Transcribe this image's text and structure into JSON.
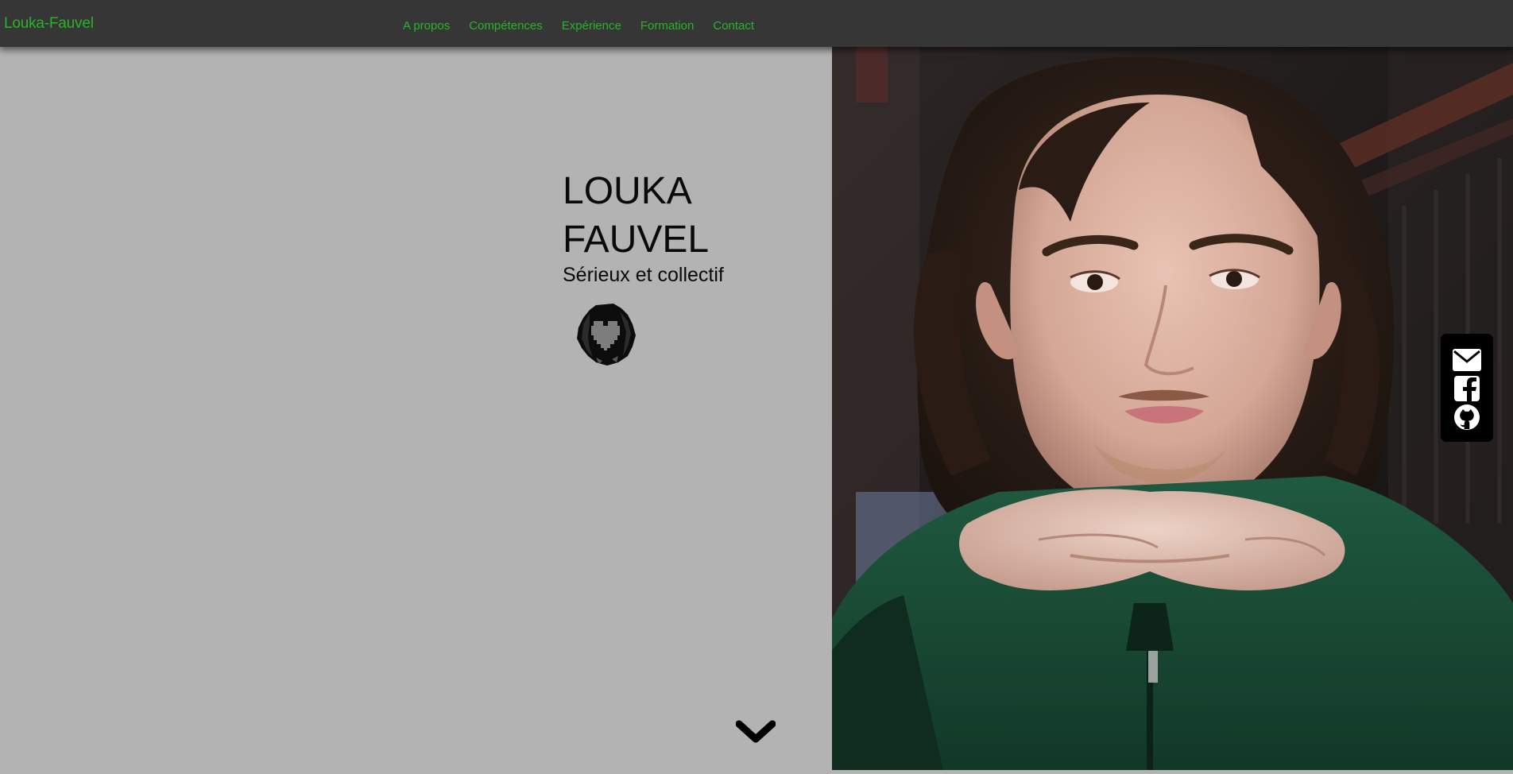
{
  "navbar": {
    "brand": "Louka-Fauvel",
    "links": [
      {
        "label": "A propos"
      },
      {
        "label": "Compétences"
      },
      {
        "label": "Expérience"
      },
      {
        "label": "Formation"
      },
      {
        "label": "Contact"
      }
    ]
  },
  "hero": {
    "first_name": "LOUKA",
    "last_name": "FAUVEL",
    "tagline": "Sérieux et collectif",
    "avatar_icon": "pixel-heart-logo-icon",
    "scroll_icon": "chevron-down-icon"
  },
  "photo": {
    "description": "portrait-photo"
  },
  "social": {
    "icons": [
      "envelope-icon",
      "facebook-icon",
      "github-icon"
    ]
  },
  "colors": {
    "accent": "#27b527",
    "navbar_bg": "#363636",
    "page_bg": "#b3b3b3",
    "social_bg": "#000000"
  }
}
